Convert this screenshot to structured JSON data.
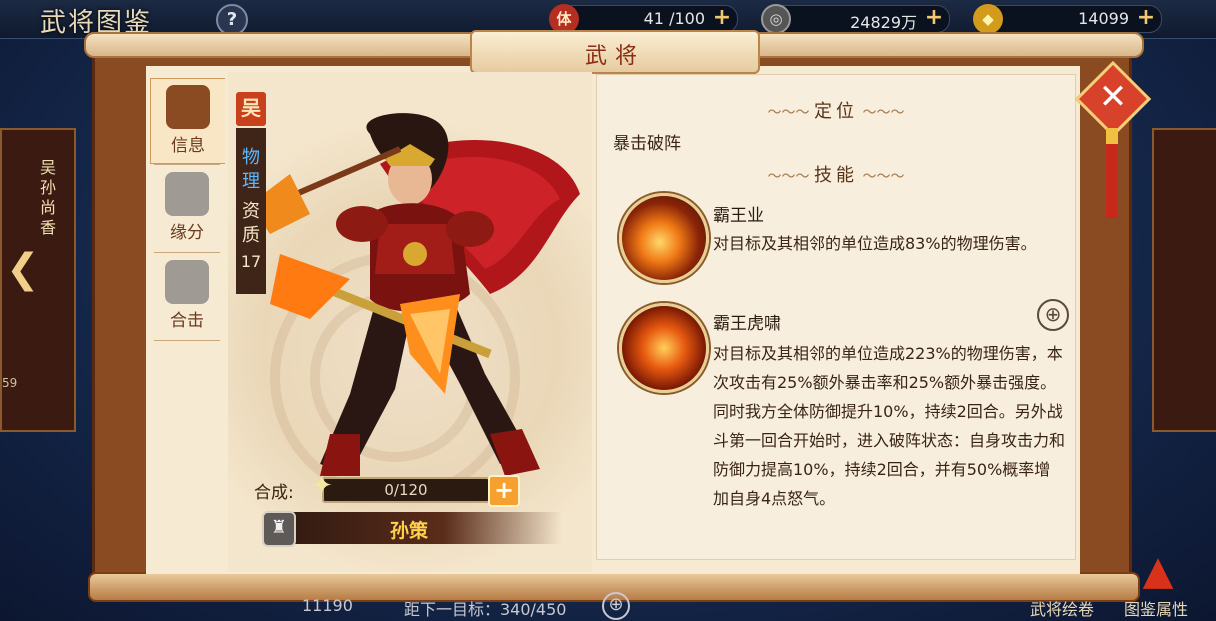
{
  "top_bar": {
    "page_title": "武将图鉴",
    "help_label": "?",
    "stamina": {
      "icon_label": "体",
      "value": "41 /100",
      "plus": "+"
    },
    "coins": {
      "icon_label": "◎",
      "value": "24829万",
      "plus": "+"
    },
    "gold": {
      "icon_label": "◆",
      "value": "14099",
      "plus": "+"
    }
  },
  "background": {
    "left_card_name": "吴 孙尚香",
    "left_card_num": "59",
    "right_card_num": ""
  },
  "panel": {
    "header_title": "武将",
    "tabs": [
      {
        "label": "信息",
        "active": true
      },
      {
        "label": "缘分",
        "active": false
      },
      {
        "label": "合击",
        "active": false
      }
    ],
    "close_label": "✕"
  },
  "hero": {
    "faction": "吴",
    "type_line1": "物理",
    "type_line2": "资质",
    "aptitude": "17",
    "synthesis_label": "合成:",
    "synthesis_value": "0/120",
    "synthesis_progress": 0.0,
    "synthesis_plus": "+",
    "name": "孙策",
    "name_color": "#ffd24a"
  },
  "info": {
    "position_title": "定位",
    "position_text": "暴击破阵",
    "skills_title": "技能",
    "skills": [
      {
        "name": "霸王业",
        "desc": "对目标及其相邻的单位造成83%的物理伤害。"
      },
      {
        "name": "霸王虎啸",
        "desc": "对目标及其相邻的单位造成223%的物理伤害，本次攻击有25%额外暴击率和25%额外暴击强度。同时我方全体防御提升10%，持续2回合。另外战斗第一回合开始时，进入破阵状态：自身攻击力和防御力提高10%，持续2回合，并有50%概率增加自身4点怒气。"
      }
    ]
  },
  "bottom": {
    "power": "11190",
    "next_target": "距下一目标：340/450",
    "btn_card": "武将绘卷",
    "btn_attr": "图鉴属性"
  }
}
